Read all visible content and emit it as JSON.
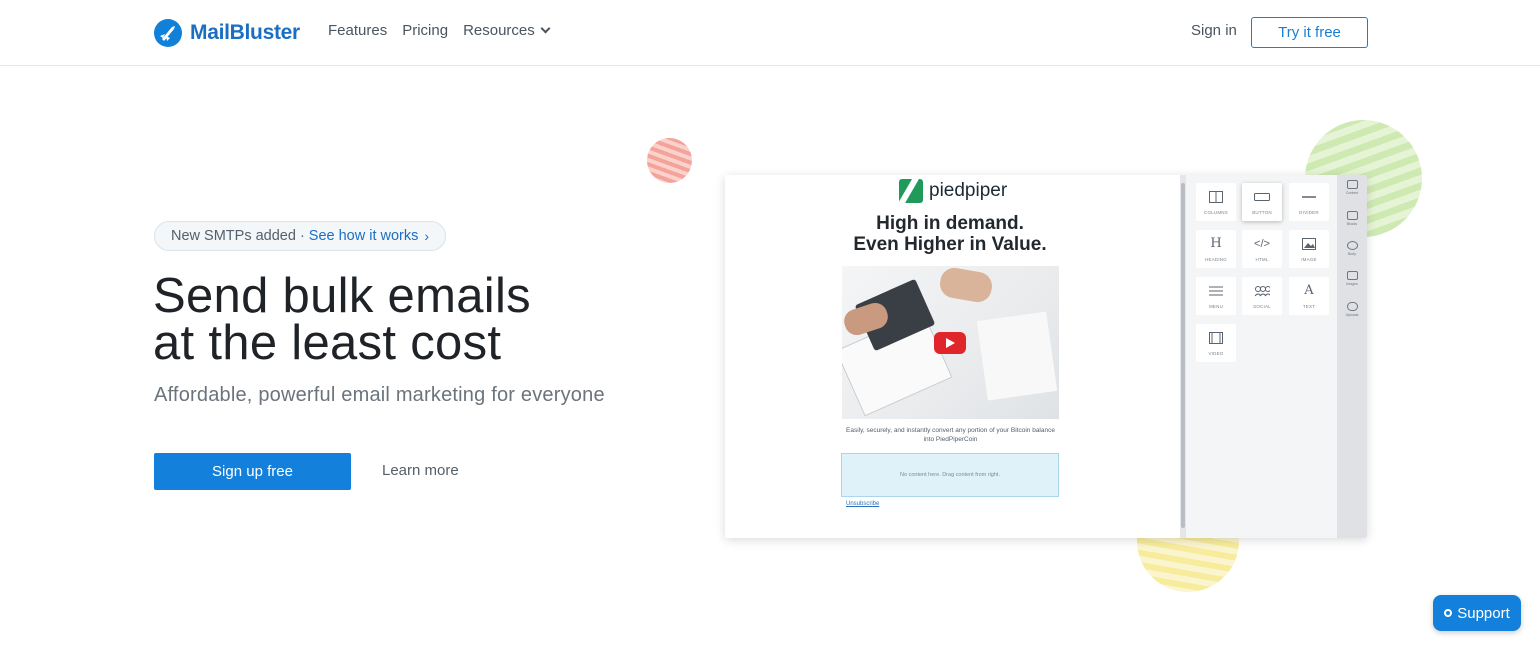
{
  "header": {
    "logo_text": "MailBluster",
    "nav": [
      {
        "label": "Features"
      },
      {
        "label": "Pricing"
      },
      {
        "label": "Resources"
      }
    ],
    "signin_label": "Sign in",
    "try_label": "Try it free"
  },
  "hero": {
    "pill_text": "New SMTPs added ·",
    "pill_link": "See how it works",
    "title_line1": "Send bulk emails",
    "title_line2": "at the least cost",
    "subtitle": "Affordable, powerful email marketing for everyone",
    "cta_label": "Sign up free",
    "learn_label": "Learn more"
  },
  "editor": {
    "brand": "piedpiper",
    "headline_line1": "High in demand.",
    "headline_line2": "Even Higher in Value.",
    "caption": "Easily, securely, and instantly convert any portion of your Bitcoin balance into PiedPiperCoin",
    "drop_text": "No content here. Drag content from right.",
    "unsubscribe": "Unsubscribe",
    "tiles": [
      "COLUMNS",
      "BUTTON",
      "DIVIDER",
      "HEADING",
      "HTML",
      "IMAGE",
      "MENU",
      "SOCIAL",
      "TEXT",
      "VIDEO"
    ],
    "side_tabs": [
      "Content",
      "Blocks",
      "Body",
      "Images",
      "Uploads"
    ]
  },
  "support_label": "Support",
  "colors": {
    "brand_blue": "#1381dc",
    "logo_blue": "#1a6fc2"
  }
}
